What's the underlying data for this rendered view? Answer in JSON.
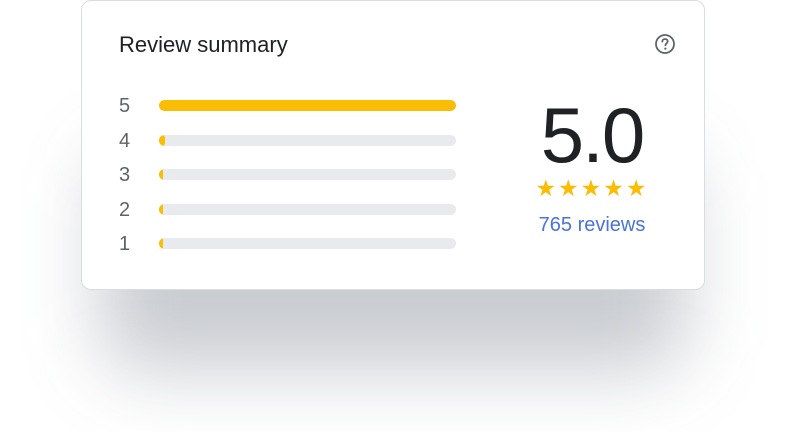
{
  "review_summary": {
    "title": "Review summary",
    "help_icon": "help-circle-icon",
    "rating": "5.0",
    "stars": "★★★★★",
    "star_count": 5,
    "reviews_link": "765 reviews",
    "distribution": [
      {
        "label": "5",
        "fraction": 1.0
      },
      {
        "label": "4",
        "fraction": 0.02
      },
      {
        "label": "3",
        "fraction": 0.01
      },
      {
        "label": "2",
        "fraction": 0.005
      },
      {
        "label": "1",
        "fraction": 0.005
      }
    ]
  },
  "colors": {
    "accent_star": "#fbbc04",
    "track": "#e8eaed",
    "link": "#4a72d8",
    "text": "#202124",
    "muted": "#5f6368"
  }
}
